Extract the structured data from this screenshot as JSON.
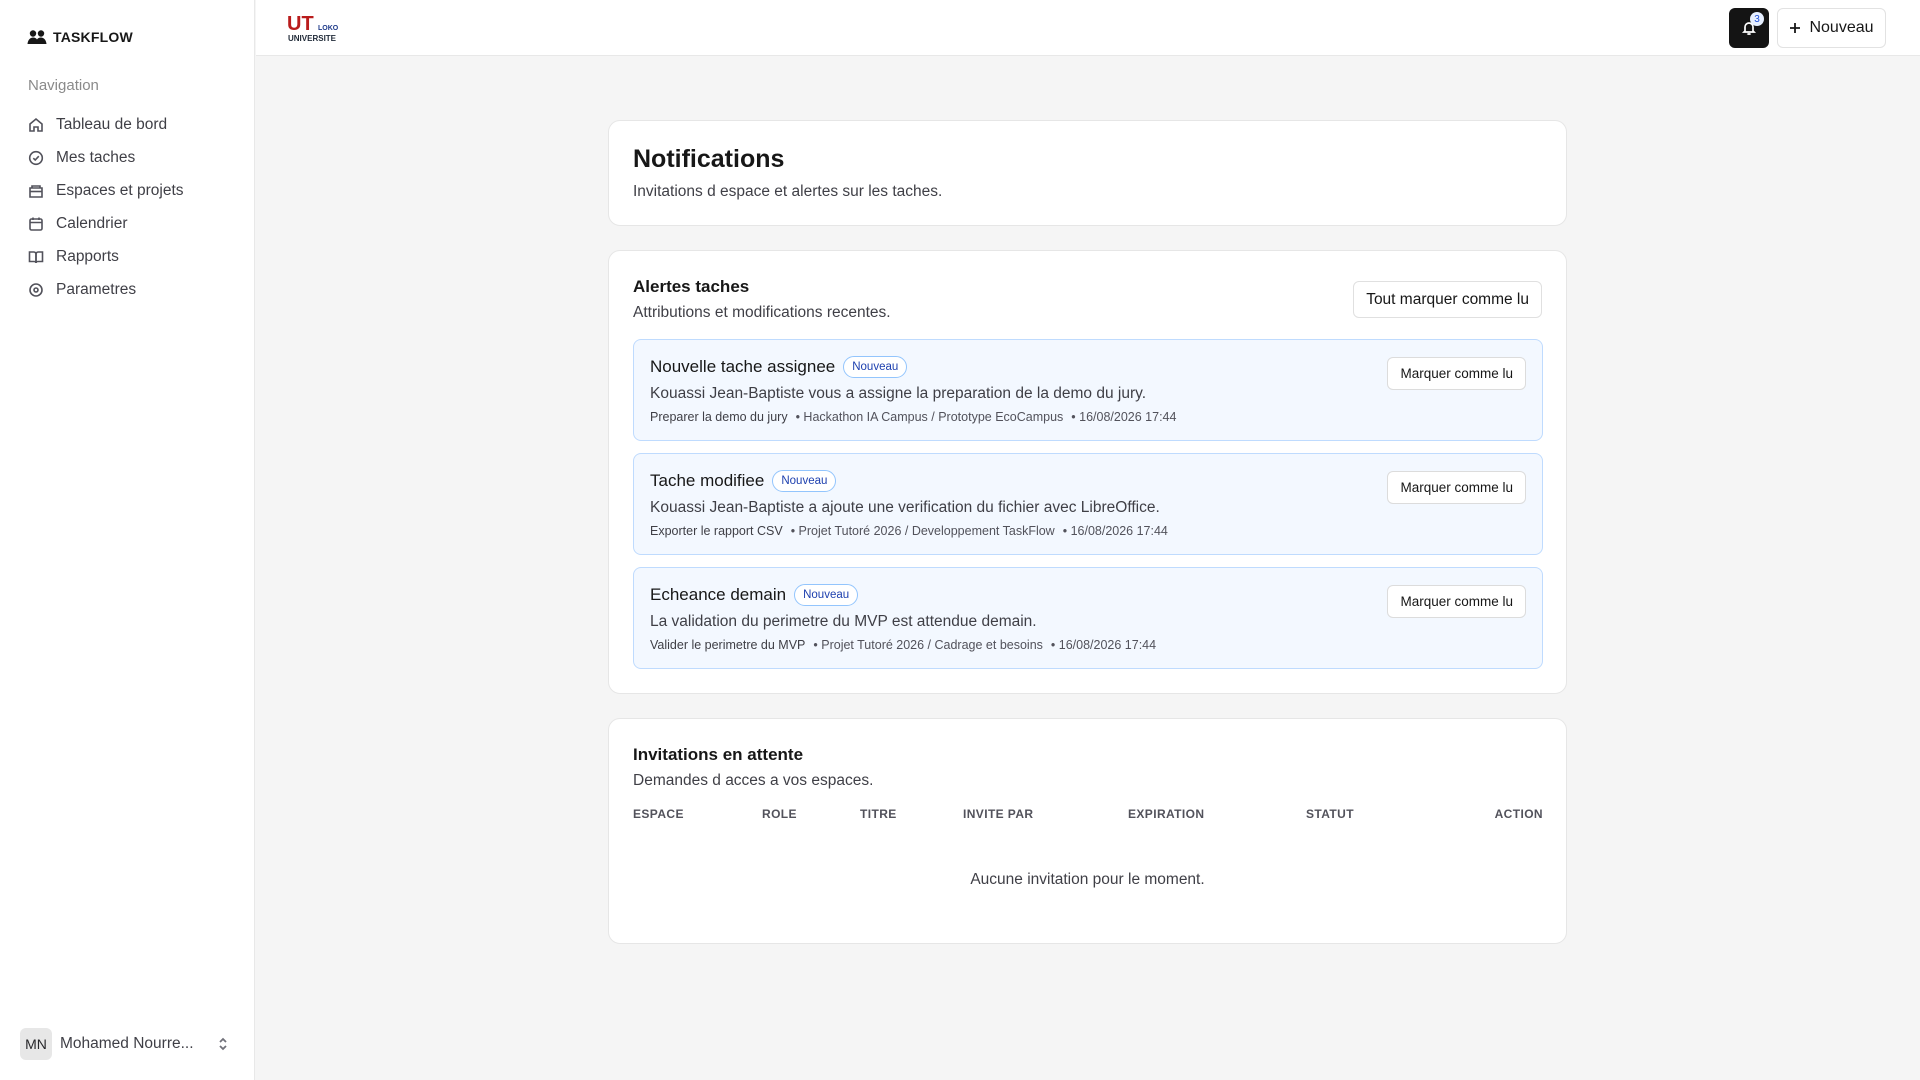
{
  "app": {
    "name": "TASKFLOW"
  },
  "logo": {
    "top_text": "UT",
    "side_text": "LOKO",
    "bottom_text": "UNIVERSITE"
  },
  "sidebar": {
    "heading": "Navigation",
    "items": [
      {
        "label": "Tableau de bord",
        "icon": "home-icon"
      },
      {
        "label": "Mes taches",
        "icon": "check-circle-icon"
      },
      {
        "label": "Espaces et projets",
        "icon": "folder-icon"
      },
      {
        "label": "Calendrier",
        "icon": "calendar-icon"
      },
      {
        "label": "Rapports",
        "icon": "book-icon"
      },
      {
        "label": "Parametres",
        "icon": "settings-icon"
      }
    ],
    "user": {
      "initials": "MN",
      "name": "Mohamed Nourre..."
    }
  },
  "topbar": {
    "notification_count": "3",
    "new_label": "Nouveau"
  },
  "header": {
    "title": "Notifications",
    "subtitle": "Invitations d espace et alertes sur les taches."
  },
  "alerts": {
    "title": "Alertes taches",
    "subtitle": "Attributions et modifications recentes.",
    "mark_all_label": "Tout marquer comme lu",
    "items": [
      {
        "title": "Nouvelle tache assignee",
        "badge": "Nouveau",
        "message": "Kouassi Jean-Baptiste vous a assigne la preparation de la demo du jury.",
        "task": "Preparer la demo du jury",
        "project": "• Hackathon IA Campus / Prototype EcoCampus",
        "date": "• 16/08/2026 17:44",
        "action": "Marquer comme lu"
      },
      {
        "title": "Tache modifiee",
        "badge": "Nouveau",
        "message": "Kouassi Jean-Baptiste a ajoute une verification du fichier avec LibreOffice.",
        "task": "Exporter le rapport CSV",
        "project": "• Projet Tutoré 2026 / Developpement TaskFlow",
        "date": "• 16/08/2026 17:44",
        "action": "Marquer comme lu"
      },
      {
        "title": "Echeance demain",
        "badge": "Nouveau",
        "message": "La validation du perimetre du MVP est attendue demain.",
        "task": "Valider le perimetre du MVP",
        "project": "• Projet Tutoré 2026 / Cadrage et besoins",
        "date": "• 16/08/2026 17:44",
        "action": "Marquer comme lu"
      }
    ]
  },
  "invitations": {
    "title": "Invitations en attente",
    "subtitle": "Demandes d acces a vos espaces.",
    "columns": [
      "ESPACE",
      "ROLE",
      "TITRE",
      "INVITE PAR",
      "EXPIRATION",
      "STATUT",
      "ACTION"
    ],
    "empty_text": "Aucune invitation pour le moment."
  }
}
